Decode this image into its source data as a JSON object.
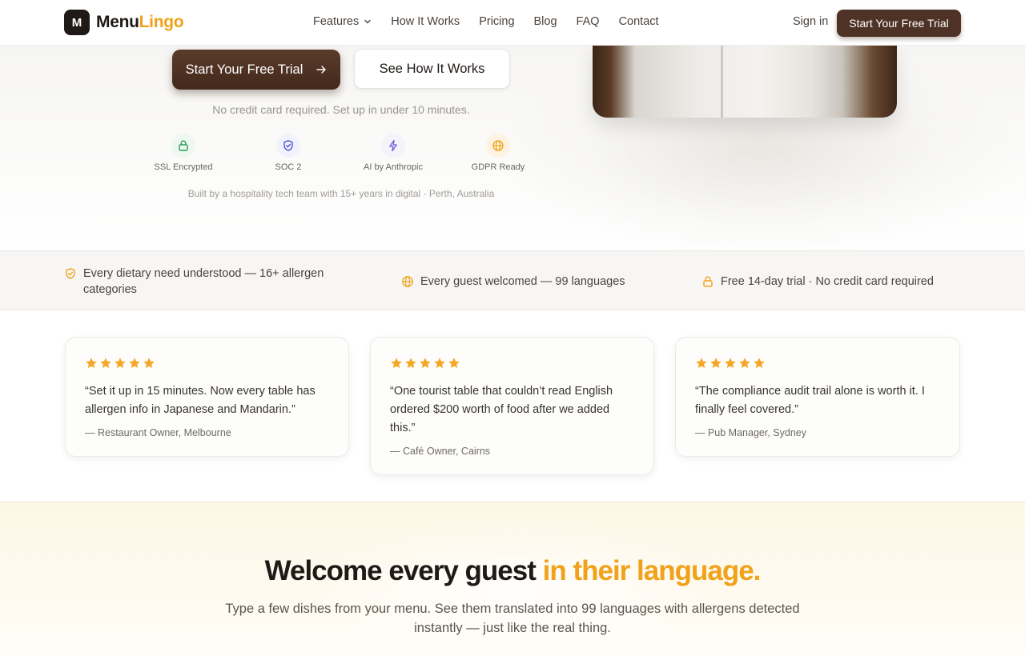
{
  "nav": {
    "logo_mark": "M",
    "logo_text_a": "Menu",
    "logo_text_b": "Lingo",
    "links": [
      "Features",
      "How It Works",
      "Pricing",
      "Blog",
      "FAQ",
      "Contact"
    ],
    "sign_in": "Sign in",
    "cta": "Start Your Free Trial"
  },
  "hero": {
    "cta_primary": "Start Your Free Trial",
    "cta_secondary": "See How It Works",
    "note": "No credit card required. Set up in under 10 minutes.",
    "badges": [
      {
        "label": "SSL Encrypted",
        "icon": "lock-icon",
        "color": "#2f9e55",
        "bg": "#eef7f0"
      },
      {
        "label": "SOC 2",
        "icon": "shield-check-icon",
        "color": "#4b55d6",
        "bg": "#f1f2fb"
      },
      {
        "label": "AI by Anthropic",
        "icon": "lightning-icon",
        "color": "#6b5bd6",
        "bg": "#f4f2fb"
      },
      {
        "label": "GDPR Ready",
        "icon": "globe-icon",
        "color": "#f0a21a",
        "bg": "#fdf3e0"
      }
    ],
    "built_by": "Built by a hospitality tech team with 15+ years in digital · Perth, Australia"
  },
  "strip": {
    "items": [
      {
        "text_line1": "Every dietary need understood — 16+ allergen",
        "text_line2": "categories",
        "icon": "shield-check-icon"
      },
      {
        "text_line1": "Every guest welcomed — 99 languages",
        "icon": "globe-icon"
      },
      {
        "text_line1": "Free 14-day trial · No credit card required",
        "icon": "lock-icon"
      }
    ],
    "accent": "#f0a21a"
  },
  "testimonials": [
    {
      "rating": 5,
      "quote_lines": [
        "“Set it up in 15 minutes. Now every table has",
        "allergen info in Japanese and Mandarin.”"
      ],
      "author": "— Restaurant Owner, Melbourne"
    },
    {
      "rating": 5,
      "quote_lines": [
        "“One tourist table that couldn’t read English",
        "ordered $200 worth of food after we added",
        "this.”"
      ],
      "author": "— Café Owner, Cairns"
    },
    {
      "rating": 5,
      "quote_lines": [
        "“The compliance audit trail alone is worth it. I",
        "finally feel covered.”"
      ],
      "author": "— Pub Manager, Sydney"
    }
  ],
  "demo": {
    "title_a": "Welcome every guest ",
    "title_b": "in their language.",
    "subtitle_line1": "Type a few dishes from your menu. See them translated into 99 languages with allergens detected",
    "subtitle_line2": "instantly — just like the real thing."
  },
  "colors": {
    "brand_dark": "#4d3225",
    "accent": "#f0a21a",
    "star": "#f5a623"
  }
}
